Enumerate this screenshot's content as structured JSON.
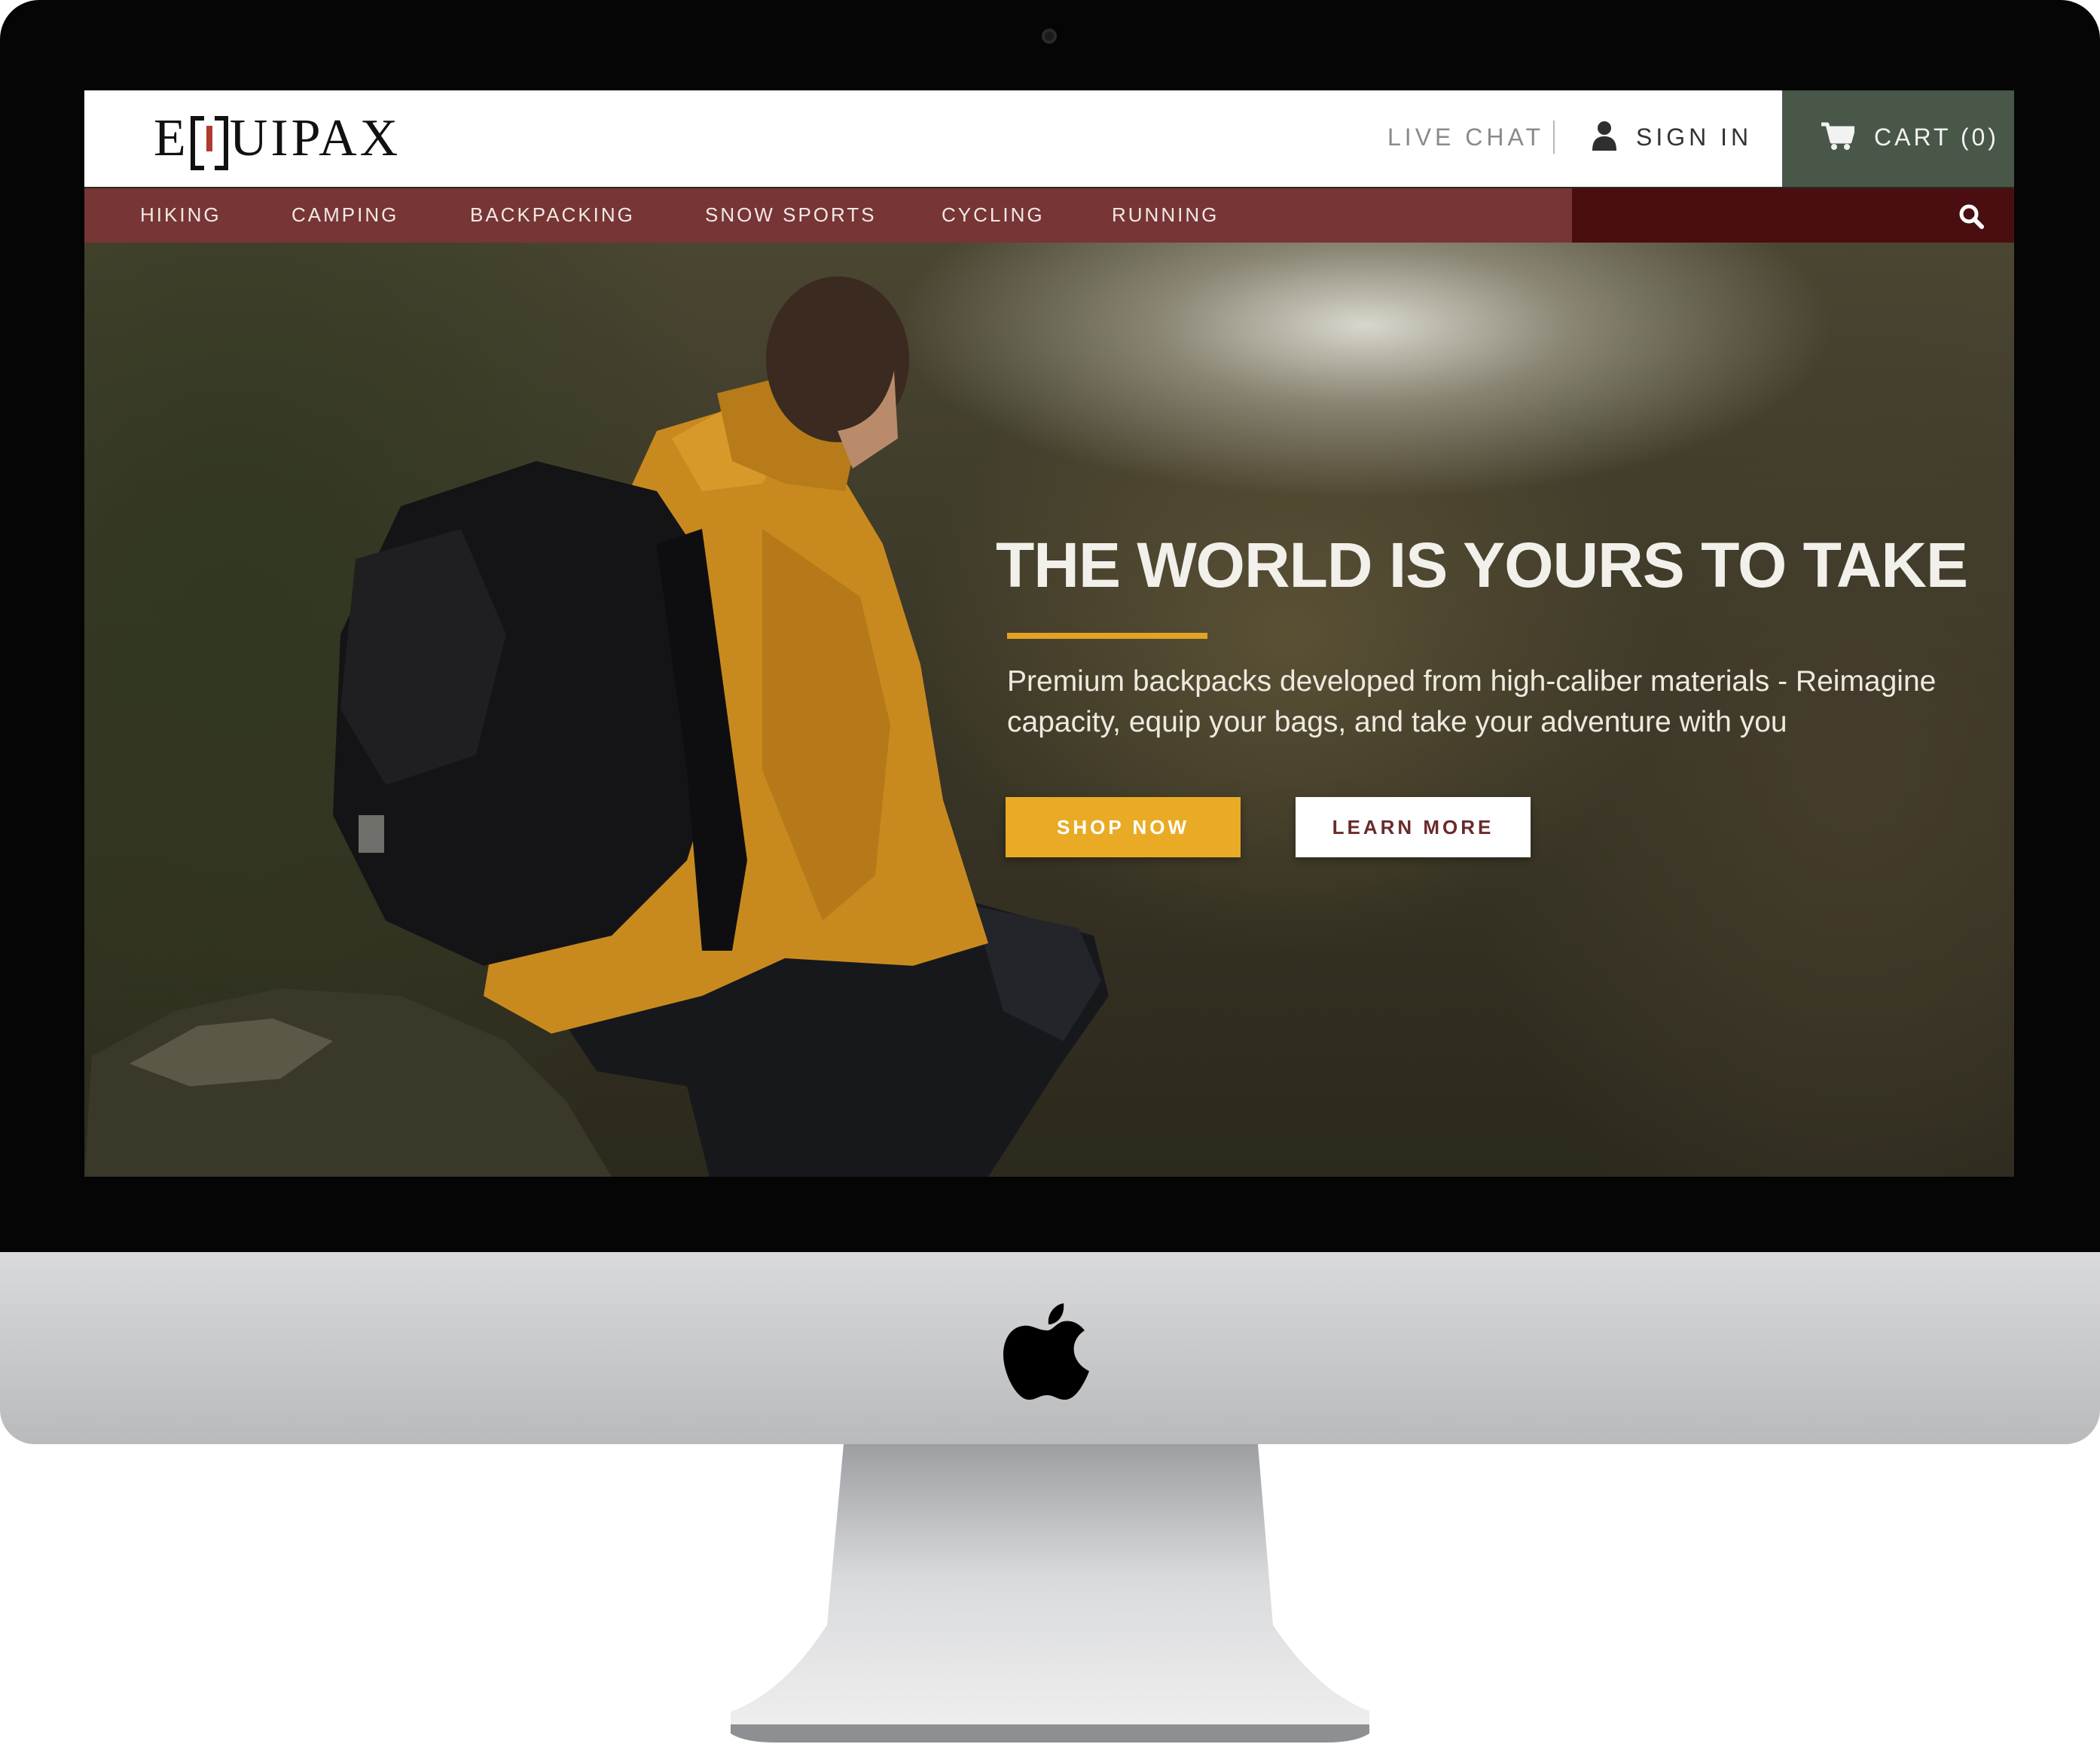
{
  "brand": {
    "logo_text_left": "E",
    "logo_text_right": "UIPAX",
    "accent_color": "#b03a2e"
  },
  "header": {
    "live_chat": "LIVE CHAT",
    "sign_in": "SIGN IN",
    "cart": "CART (0)",
    "cart_color": "#485748"
  },
  "nav": {
    "items": [
      "HIKING",
      "CAMPING",
      "BACKPACKING",
      "SNOW SPORTS",
      "CYCLING",
      "RUNNING"
    ],
    "bar_color": "#773536",
    "search_zone_color": "#4b0e10",
    "search_icon": "search-icon"
  },
  "hero": {
    "title": "THE WORLD IS YOURS TO TAKE",
    "subtitle": "Premium backpacks developed from high-caliber materials - Reimagine capacity, equip your bags, and take your adventure with you",
    "primary_cta": "SHOP NOW",
    "secondary_cta": "LEARN MORE",
    "primary_cta_color": "#e9ab26",
    "rule_color": "#e2a224"
  },
  "device": {
    "icons": [
      "camera-icon",
      "apple-logo-icon"
    ]
  }
}
